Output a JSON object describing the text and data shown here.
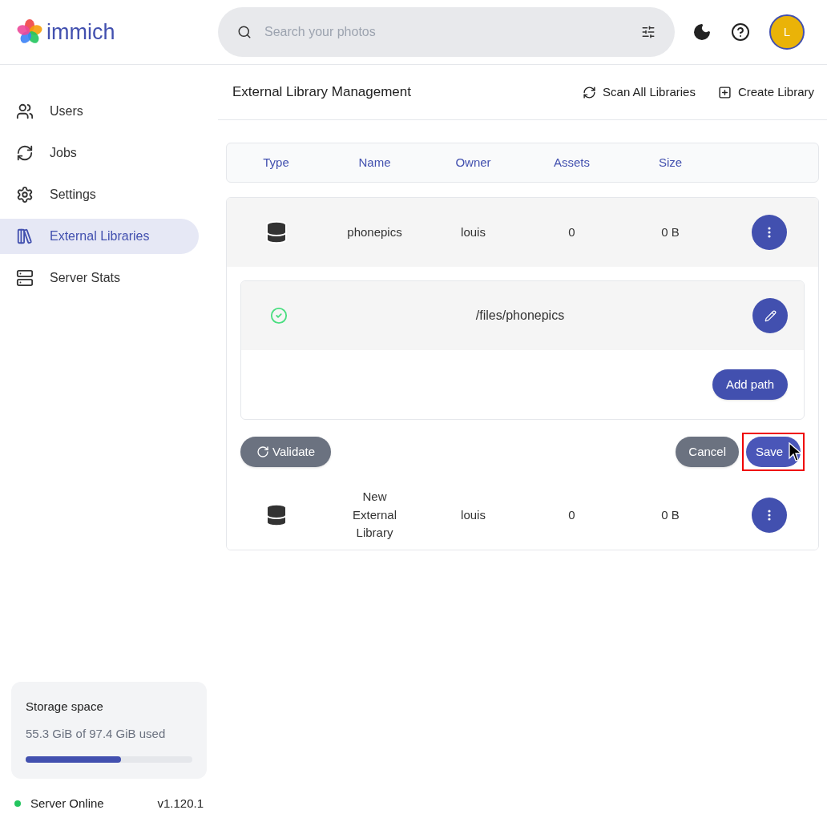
{
  "header": {
    "logo_text": "immich",
    "search": {
      "placeholder": "Search your photos"
    },
    "avatar_initial": "L"
  },
  "sidebar": {
    "items": [
      {
        "label": "Users",
        "kind": "users",
        "selected": false
      },
      {
        "label": "Jobs",
        "kind": "jobs",
        "selected": false
      },
      {
        "label": "Settings",
        "kind": "settings",
        "selected": false
      },
      {
        "label": "External Libraries",
        "kind": "libraries",
        "selected": true
      },
      {
        "label": "Server Stats",
        "kind": "stats",
        "selected": false
      }
    ],
    "storage": {
      "title": "Storage space",
      "usage": "55.3 GiB of 97.4 GiB used",
      "level": 0.57
    },
    "status": {
      "label": "Server Online",
      "color": "#22c55e",
      "version": "v1.120.1"
    }
  },
  "page": {
    "title": "External Library Management",
    "actions": [
      {
        "label": "Scan All Libraries",
        "kind": "scan"
      },
      {
        "label": "Create Library",
        "kind": "create"
      }
    ]
  },
  "table": {
    "columns": [
      "Type",
      "Name",
      "Owner",
      "Assets",
      "Size"
    ],
    "rows": [
      {
        "name": "phonepics",
        "owner": "louis",
        "assets": "0",
        "size": "0 B",
        "expanded": true,
        "paths": [
          {
            "path": "/files/phonepics",
            "valid": true
          }
        ],
        "add_path_label": "Add path",
        "validate_label": "Validate",
        "cancel_label": "Cancel",
        "save_label": "Save"
      },
      {
        "name": "New External Library",
        "owner": "louis",
        "assets": "0",
        "size": "0 B",
        "expanded": false
      }
    ]
  }
}
